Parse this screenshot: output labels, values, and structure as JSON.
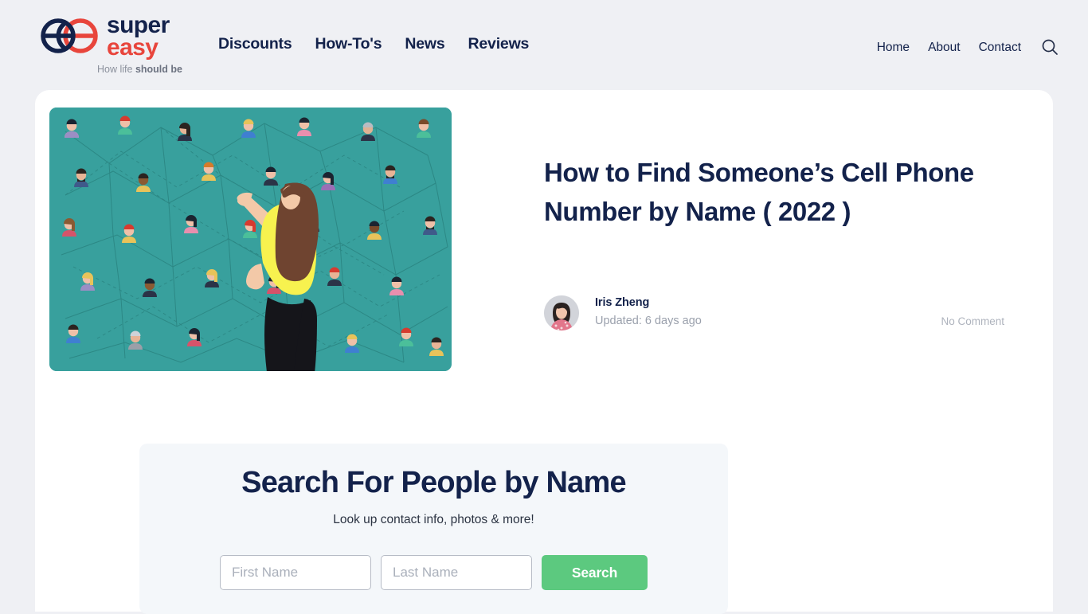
{
  "brand": {
    "logo_icon": "double-e-logo-icon",
    "name_line1": "super",
    "name_line2": "easy",
    "tagline_prefix": "How life ",
    "tagline_bold": "should be",
    "navy": "#13224b",
    "red": "#e8453c"
  },
  "header": {
    "main_nav": [
      {
        "label": "Discounts"
      },
      {
        "label": "How-To's"
      },
      {
        "label": "News"
      },
      {
        "label": "Reviews"
      }
    ],
    "util_nav": [
      {
        "label": "Home"
      },
      {
        "label": "About"
      },
      {
        "label": "Contact"
      }
    ],
    "search_icon": "search-icon"
  },
  "article": {
    "hero_image_alt": "people-network-illustration",
    "title": "How to Find Someone’s Cell Phone Number by Name ( 2022 )",
    "author": "Iris Zheng",
    "updated": "Updated: 6 days ago",
    "comments": "No Comment"
  },
  "search_widget": {
    "title": "Search For People by Name",
    "subtitle": "Look up contact info, photos & more!",
    "first_name_value": "",
    "first_name_placeholder": "First Name",
    "last_name_value": "",
    "last_name_placeholder": "Last Name",
    "submit_label": "Search",
    "submit_color": "#5cc97f"
  }
}
